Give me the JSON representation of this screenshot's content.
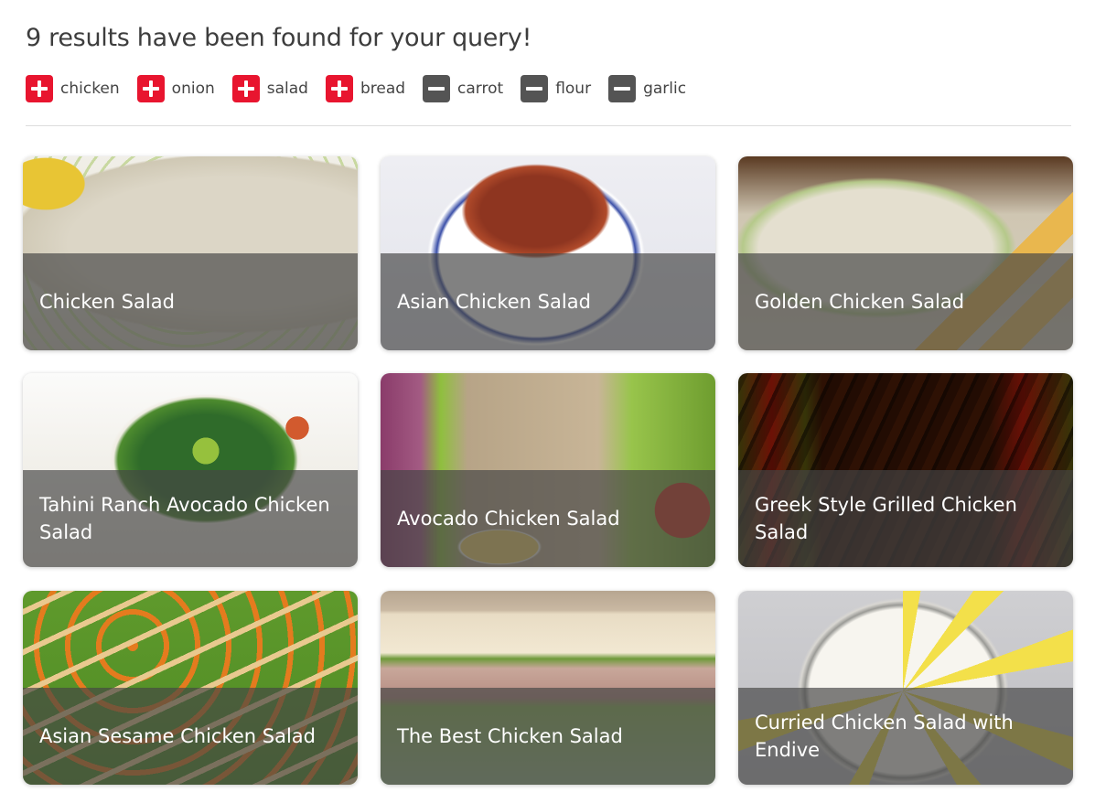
{
  "results": {
    "heading": "9 results have been found for your query!"
  },
  "filters": [
    {
      "label": "chicken",
      "mode": "include"
    },
    {
      "label": "onion",
      "mode": "include"
    },
    {
      "label": "salad",
      "mode": "include"
    },
    {
      "label": "bread",
      "mode": "include"
    },
    {
      "label": "carrot",
      "mode": "exclude"
    },
    {
      "label": "flour",
      "mode": "exclude"
    },
    {
      "label": "garlic",
      "mode": "exclude"
    }
  ],
  "colors": {
    "include": "#e8152f",
    "exclude": "#545454",
    "overlay": "#464646"
  },
  "recipes": [
    {
      "title": "Chicken Salad"
    },
    {
      "title": "Asian Chicken Salad"
    },
    {
      "title": "Golden Chicken Salad"
    },
    {
      "title": "Tahini Ranch Avocado Chicken Salad"
    },
    {
      "title": "Avocado Chicken Salad"
    },
    {
      "title": "Greek Style Grilled Chicken Salad"
    },
    {
      "title": "Asian Sesame Chicken Salad"
    },
    {
      "title": "The Best Chicken Salad"
    },
    {
      "title": "Curried Chicken Salad with Endive"
    }
  ]
}
